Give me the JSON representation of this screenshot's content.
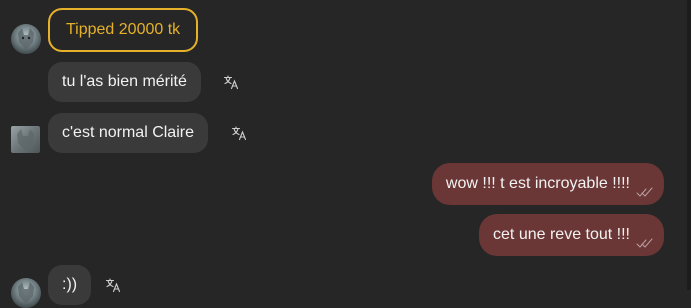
{
  "chat": {
    "messages": [
      {
        "sender": "other",
        "type": "tip",
        "text": "Tipped 20000 tk"
      },
      {
        "sender": "other",
        "type": "text",
        "text": "tu l'as bien mérité",
        "translate_icon": "translate-icon"
      },
      {
        "sender": "other",
        "type": "text",
        "text": "c'est normal Claire",
        "translate_icon": "translate-icon"
      },
      {
        "sender": "me",
        "type": "text",
        "text": "wow !!! t est incroyable !!!!",
        "status_icon": "double-check-icon"
      },
      {
        "sender": "me",
        "type": "text",
        "text": "cet une reve tout !!!",
        "status_icon": "double-check-icon"
      },
      {
        "sender": "other",
        "type": "text",
        "text": ":))",
        "translate_icon": "translate-icon"
      }
    ]
  },
  "colors": {
    "background": "#262626",
    "incoming_bubble": "#3a3a3a",
    "outgoing_bubble": "#6b3636",
    "tip_accent": "#e6b12a",
    "text": "#f2f2f2"
  }
}
